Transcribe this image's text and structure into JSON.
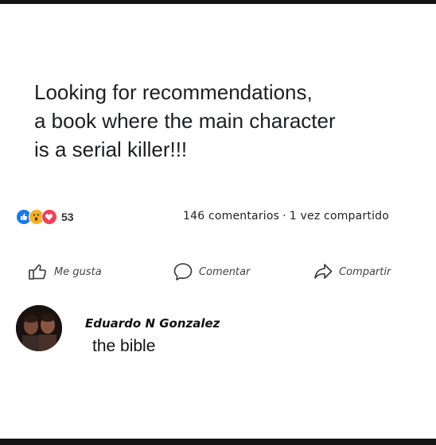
{
  "post": {
    "lines": [
      "Looking for recommendations,",
      "a book where the main character",
      "is a serial killer!!!"
    ]
  },
  "reactions": {
    "icons": [
      "like-icon",
      "wow-icon",
      "love-icon"
    ],
    "count": "53",
    "comments": "146 comentarios",
    "separator": "·",
    "shares": "1 vez compartido"
  },
  "actions": {
    "like_label": "Me gusta",
    "comment_label": "Comentar",
    "share_label": "Compartir"
  },
  "comment": {
    "author": "Eduardo N Gonzalez",
    "text": "the bible"
  },
  "colors": {
    "like": "#1877f2",
    "wow": "#f7b125",
    "love": "#f33e58"
  }
}
